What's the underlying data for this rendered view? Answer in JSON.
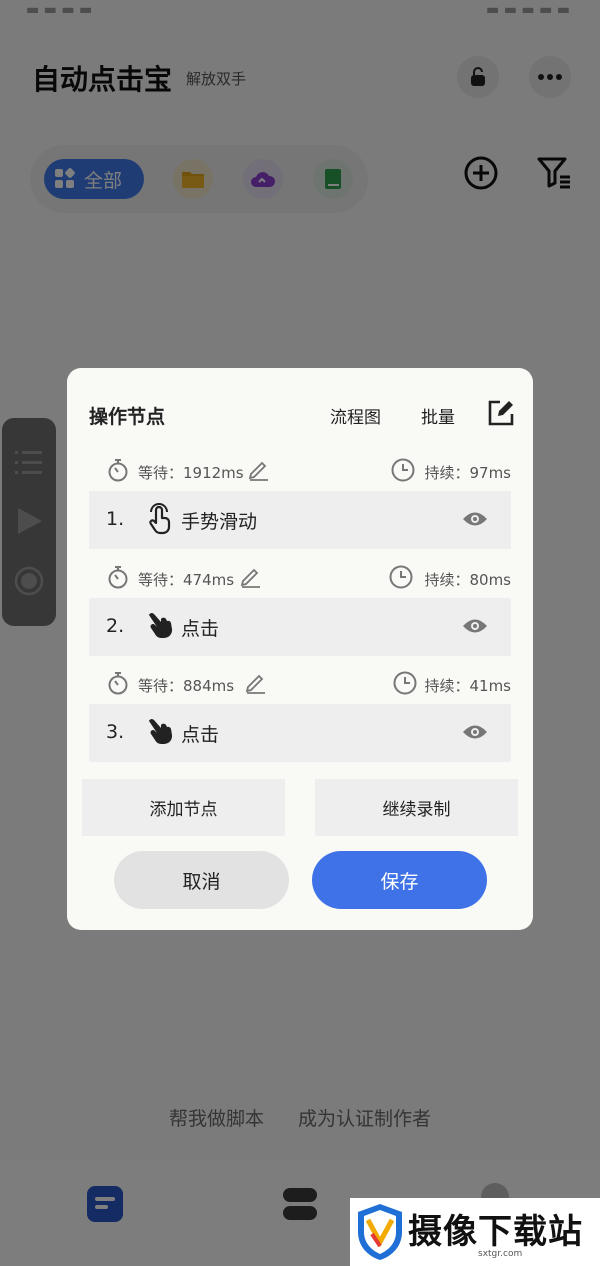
{
  "app": {
    "title": "自动点击宝",
    "subtitle": "解放双手"
  },
  "categories": {
    "all_label": "全部"
  },
  "footer": {
    "help_link": "帮我做脚本",
    "author_link": "成为认证制作者"
  },
  "watermark": {
    "text": "摄像下载站",
    "url": "sxtgr.com"
  },
  "dialog": {
    "title": "操作节点",
    "flow_label": "流程图",
    "batch_label": "批量",
    "nodes": [
      {
        "index": "1.",
        "action": "手势滑动",
        "wait": "等待：1912ms",
        "duration": "持续：97ms"
      },
      {
        "index": "2.",
        "action": "点击",
        "wait": "等待：474ms",
        "duration": "持续：80ms"
      },
      {
        "index": "3.",
        "action": "点击",
        "wait": "等待：884ms",
        "duration": "持续：41ms"
      }
    ],
    "add_node_label": "添加节点",
    "continue_record_label": "继续录制",
    "cancel_label": "取消",
    "save_label": "保存"
  },
  "colors": {
    "accent": "#3e72e6",
    "category_active": "#3f7ae8",
    "tab_active": "#2a56c6"
  }
}
